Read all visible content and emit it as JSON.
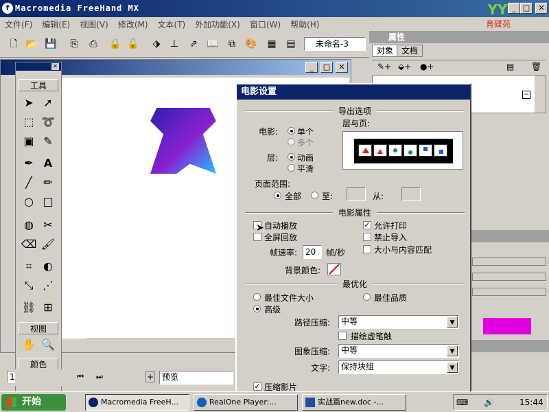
{
  "window": {
    "title": "Macromedia FreeHand MX",
    "logo_text": "育碟苑"
  },
  "menu": [
    "文件(F)",
    "编辑(E)",
    "视图(V)",
    "修改(M)",
    "文本(T)",
    "外加功能(X)",
    "窗口(W)",
    "帮助(H)"
  ],
  "toolbar": {
    "document_name": "未命名-3"
  },
  "tools_panel": {
    "tools_label": "工具",
    "view_label": "视图",
    "color_label": "颜色"
  },
  "right_panel": {
    "title": "属性",
    "tabs": [
      "对象",
      "文档"
    ]
  },
  "bottom_bar": {
    "zoom": "1",
    "view_mode": "预览"
  },
  "dialog": {
    "title": "电影设置",
    "export_section": "导出选项",
    "movie_label": "电影:",
    "movie_single": "单个",
    "movie_multiple": "多个",
    "layers_pages_label": "层与页:",
    "layer_label": "层:",
    "layer_animate": "动画",
    "layer_flatten": "平滑",
    "page_range_label": "页面范围:",
    "page_all": "全部",
    "page_to": "至:",
    "page_from": "从:",
    "movie_props_section": "电影属性",
    "autoplay": "自动播放",
    "allow_print": "允许打印",
    "fullscreen": "全屏回放",
    "prevent_import": "禁止导入",
    "fit_content": "大小与内容匹配",
    "frame_rate_label": "帧速率:",
    "frame_rate_value": "20",
    "frame_rate_unit": "帧/秒",
    "bg_color_label": "背景颜色:",
    "optimize_section": "最优化",
    "best_file_size": "最佳文件大小",
    "best_quality": "最佳品质",
    "high": "高级",
    "path_compression_label": "路径压缩:",
    "path_compression_value": "中等",
    "trace_dash": "描绘虚笔触",
    "image_compression_label": "图象压缩:",
    "image_compression_value": "中等",
    "text_label": "文字:",
    "text_value": "保持块组",
    "compress_movie": "压缩影片"
  },
  "taskbar": {
    "start": "开始",
    "tasks": [
      "Macromedia FreeH...",
      "RealOne Player:...",
      "实战篇new.doc -..."
    ],
    "clock": "15:44"
  },
  "colors": {
    "titlebar": "#0a246a",
    "magenta_swatch": "#e000e0"
  }
}
